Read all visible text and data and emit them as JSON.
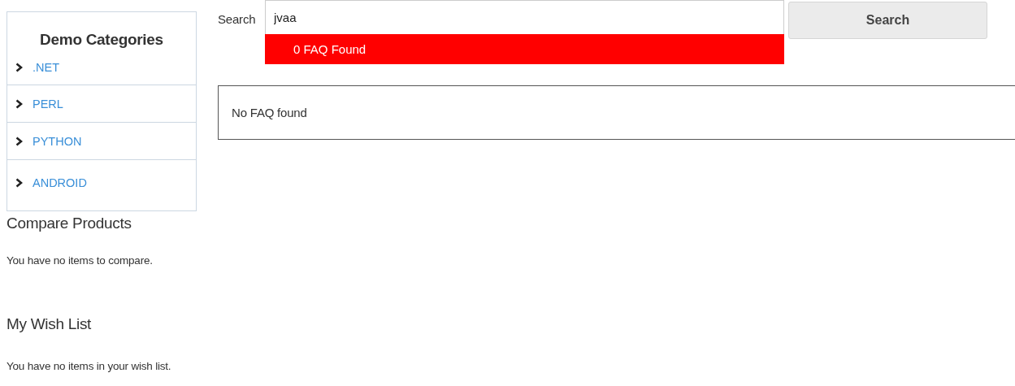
{
  "sidebar": {
    "title": "Demo Categories",
    "items": [
      {
        "label": ".NET"
      },
      {
        "label": "PERL"
      },
      {
        "label": "PYTHON"
      },
      {
        "label": "ANDROID"
      }
    ]
  },
  "compare": {
    "title": "Compare Products",
    "message": "You have no items to compare."
  },
  "wishlist": {
    "title": "My Wish List",
    "message": "You have no items in your wish list."
  },
  "search": {
    "label": "Search",
    "value": "jvaa",
    "button": "Search",
    "suggestion": "0 FAQ Found"
  },
  "results": {
    "message": "No FAQ found"
  }
}
